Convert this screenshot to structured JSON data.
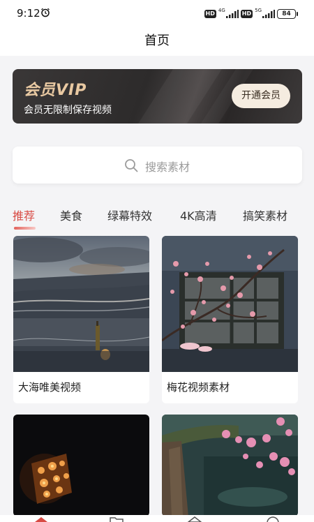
{
  "status_bar": {
    "time": "9:12",
    "alarm_icon": "alarm-clock-icon",
    "hd_label": "HD",
    "network_1": "4G",
    "network_2": "5G",
    "battery": "84"
  },
  "header": {
    "title": "首页"
  },
  "vip": {
    "title": "会员VIP",
    "subtitle": "会员无限制保存视频",
    "button_label": "开通会员",
    "accent_color": "#e9c9a2"
  },
  "search": {
    "placeholder": "搜索素材",
    "icon": "search-icon"
  },
  "tabs": [
    {
      "label": "推荐",
      "active": true
    },
    {
      "label": "美食",
      "active": false
    },
    {
      "label": "绿幕特效",
      "active": false
    },
    {
      "label": "4K高清",
      "active": false
    },
    {
      "label": "搞笑素材",
      "active": false
    }
  ],
  "accent_color": "#d84a44",
  "videos": [
    {
      "title": "大海唯美视频",
      "thumbnail": "sunset-sea-beach-image"
    },
    {
      "title": "梅花视频素材",
      "thumbnail": "plum-blossom-window-image"
    },
    {
      "title": "",
      "thumbnail": "candle-lantern-night-image"
    },
    {
      "title": "",
      "thumbnail": "plum-blossom-cliff-image"
    }
  ]
}
